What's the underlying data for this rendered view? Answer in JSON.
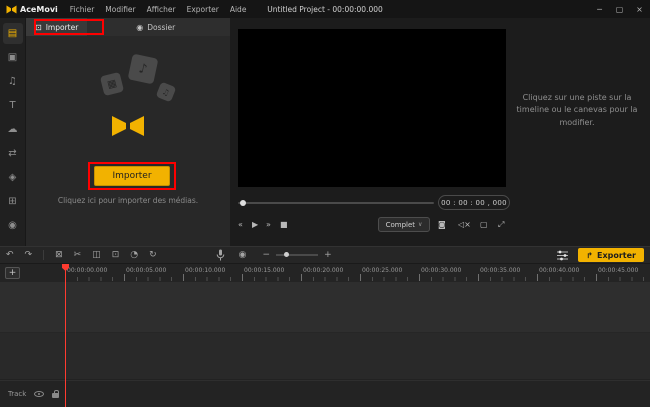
{
  "colors": {
    "accent": "#f2b200",
    "annotation": "#ff0000",
    "playhead": "#ff3b30"
  },
  "titlebar": {
    "app_name": "AceMovi",
    "menus": [
      "Fichier",
      "Modifier",
      "Afficher",
      "Exporter",
      "Aide"
    ],
    "project_title": "Untitled Project - 00:00:00.000",
    "window_controls": {
      "minimize": "─",
      "maximize": "▢",
      "close": "×"
    }
  },
  "sidebar": {
    "items": [
      {
        "id": "media",
        "glyph": "▤"
      },
      {
        "id": "stock",
        "glyph": "▣"
      },
      {
        "id": "audio",
        "glyph": "♫"
      },
      {
        "id": "text",
        "glyph": "T"
      },
      {
        "id": "elements",
        "glyph": "☁"
      },
      {
        "id": "transitions",
        "glyph": "⇄"
      },
      {
        "id": "effects",
        "glyph": "◈"
      },
      {
        "id": "split-screen",
        "glyph": "⊞"
      },
      {
        "id": "record",
        "glyph": "◉"
      }
    ]
  },
  "media_panel": {
    "tabs": [
      {
        "label": "Importer",
        "icon": "⊡"
      },
      {
        "label": "Dossier",
        "icon": "◉"
      }
    ],
    "illustration": {
      "tile1": "♪",
      "tile2": "▦",
      "tile3": "♫"
    },
    "import_button": "Importer",
    "hint": "Cliquez ici pour importer des médias."
  },
  "preview": {
    "hint": "Cliquez sur une piste sur la timeline ou le canevas pour la modifier.",
    "timecode": "00 : 00 : 00 , 000",
    "fit_label": "Complet",
    "transport": {
      "prev": "«",
      "play": "▶",
      "next": "»",
      "stop": "■"
    },
    "icons": {
      "chevron": "∨",
      "snapshot": "◙",
      "mute": "◁×",
      "device": "▢",
      "fullscreen": "⤢"
    }
  },
  "toolbar": {
    "icons": {
      "undo": "↶",
      "redo": "↷",
      "delete": "⊠",
      "scissors": "✂",
      "split": "◫",
      "crop": "⊡",
      "speed": "◔",
      "rotate": "↻",
      "record": "◉",
      "zoom_out": "−",
      "zoom_in": "+"
    },
    "export_label": "Exporter",
    "export_icon": "↱"
  },
  "timeline": {
    "add_track": "+",
    "ruler_labels": [
      "00:00:00.000",
      "00:00:05.000",
      "00:00:10.000",
      "00:00:15.000",
      "00:00:20.000",
      "00:00:25.000",
      "00:00:30.000",
      "00:00:35.000",
      "00:00:40.000",
      "00:00:45.000"
    ],
    "track_label": "Track"
  }
}
